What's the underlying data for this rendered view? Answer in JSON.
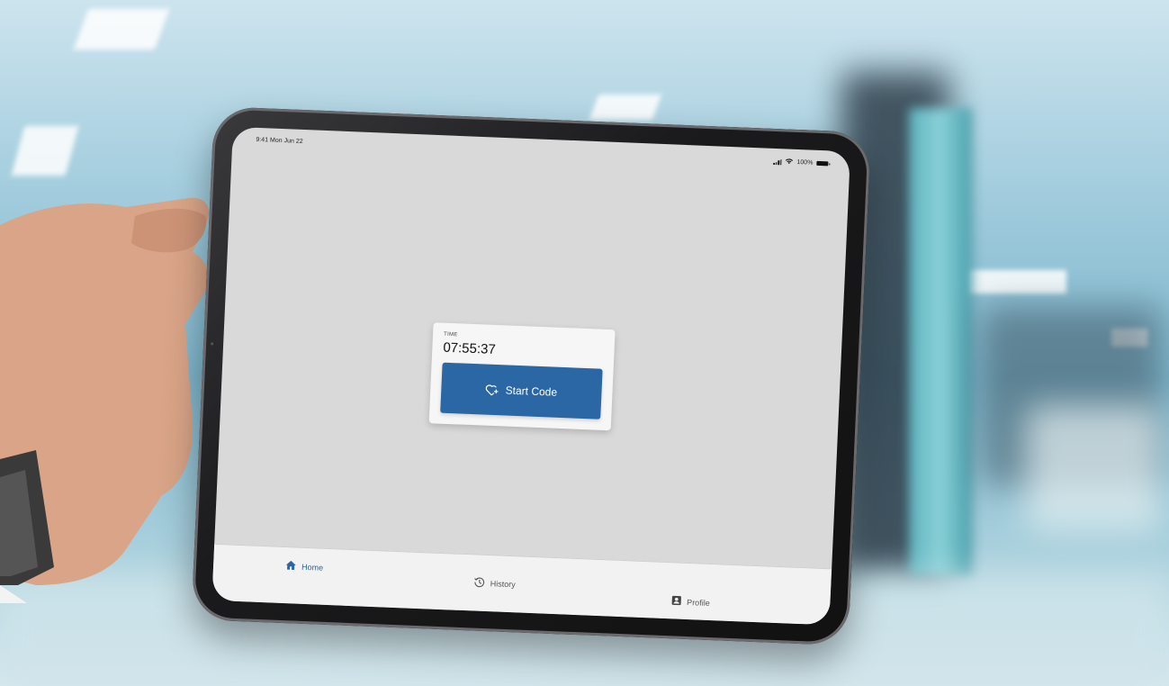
{
  "status_bar": {
    "time": "9:41",
    "date": "Mon Jun 22",
    "battery": "100%"
  },
  "timer_card": {
    "label": "TIME",
    "value": "07:55:37",
    "button_label": "Start Code",
    "button_icon": "heart-plus-icon"
  },
  "tabs": [
    {
      "label": "Home",
      "icon": "home-icon",
      "active": true
    },
    {
      "label": "History",
      "icon": "history-icon",
      "active": false
    },
    {
      "label": "Profile",
      "icon": "profile-icon",
      "active": false
    }
  ],
  "colors": {
    "accent": "#2a67a4",
    "screen_bg": "#d9d9d9",
    "tab_bar_bg": "#f2f2f2"
  }
}
